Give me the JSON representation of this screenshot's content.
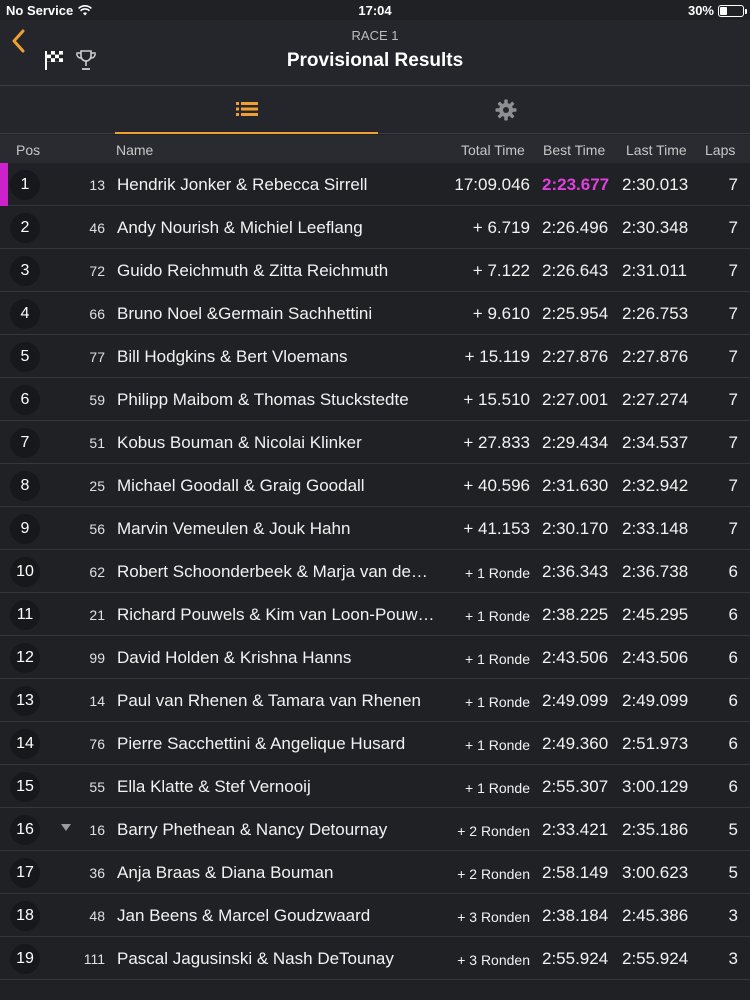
{
  "status_bar": {
    "carrier": "No Service",
    "time": "17:04",
    "battery": "30%",
    "battery_level": 0.3
  },
  "header": {
    "subtitle": "RACE 1",
    "title": "Provisional Results",
    "icons": [
      "chevron-left-icon",
      "checkered-flag-icon",
      "trophy-icon"
    ]
  },
  "tabs": [
    {
      "icon": "list-icon",
      "active": true
    },
    {
      "icon": "gear-icon",
      "active": false
    }
  ],
  "columns": {
    "pos": "Pos",
    "name": "Name",
    "total": "Total Time",
    "best": "Best Time",
    "last": "Last Time",
    "laps": "Laps"
  },
  "colors": {
    "accent": "#f0a030",
    "best_highlight": "#e040e0"
  },
  "rows": [
    {
      "pos": "1",
      "num": "13",
      "name": "Hendrik Jonker & Rebecca Sirrell",
      "total": "17:09.046",
      "best": "2:23.677",
      "last": "2:30.013",
      "laps": "7",
      "fastest": true
    },
    {
      "pos": "2",
      "num": "46",
      "name": "Andy Nourish & Michiel Leeflang",
      "total": "+ 6.719",
      "best": "2:26.496",
      "last": "2:30.348",
      "laps": "7"
    },
    {
      "pos": "3",
      "num": "72",
      "name": "Guido Reichmuth & Zitta Reichmuth",
      "total": "+ 7.122",
      "best": "2:26.643",
      "last": "2:31.011",
      "laps": "7"
    },
    {
      "pos": "4",
      "num": "66",
      "name": "Bruno Noel &Germain Sachhettini",
      "total": "+ 9.610",
      "best": "2:25.954",
      "last": "2:26.753",
      "laps": "7"
    },
    {
      "pos": "5",
      "num": "77",
      "name": "Bill Hodgkins & Bert Vloemans",
      "total": "+ 15.119",
      "best": "2:27.876",
      "last": "2:27.876",
      "laps": "7"
    },
    {
      "pos": "6",
      "num": "59",
      "name": "Philipp Maibom & Thomas Stuckstedte",
      "total": "+ 15.510",
      "best": "2:27.001",
      "last": "2:27.274",
      "laps": "7"
    },
    {
      "pos": "7",
      "num": "51",
      "name": "Kobus Bouman & Nicolai Klinker",
      "total": "+ 27.833",
      "best": "2:29.434",
      "last": "2:34.537",
      "laps": "7"
    },
    {
      "pos": "8",
      "num": "25",
      "name": "Michael Goodall & Graig Goodall",
      "total": "+ 40.596",
      "best": "2:31.630",
      "last": "2:32.942",
      "laps": "7"
    },
    {
      "pos": "9",
      "num": "56",
      "name": "Marvin Vemeulen & Jouk Hahn",
      "total": "+ 41.153",
      "best": "2:30.170",
      "last": "2:33.148",
      "laps": "7"
    },
    {
      "pos": "10",
      "num": "62",
      "name": "Robert Schoonderbeek & Marja van de…",
      "total": "+ 1 Ronde",
      "best": "2:36.343",
      "last": "2:36.738",
      "laps": "6"
    },
    {
      "pos": "11",
      "num": "21",
      "name": "Richard Pouwels & Kim van Loon-Pouw…",
      "total": "+ 1 Ronde",
      "best": "2:38.225",
      "last": "2:45.295",
      "laps": "6"
    },
    {
      "pos": "12",
      "num": "99",
      "name": "David Holden & Krishna Hanns",
      "total": "+ 1 Ronde",
      "best": "2:43.506",
      "last": "2:43.506",
      "laps": "6"
    },
    {
      "pos": "13",
      "num": "14",
      "name": "Paul van Rhenen & Tamara van Rhenen",
      "total": "+ 1 Ronde",
      "best": "2:49.099",
      "last": "2:49.099",
      "laps": "6"
    },
    {
      "pos": "14",
      "num": "76",
      "name": "Pierre Sacchettini & Angelique Husard",
      "total": "+ 1 Ronde",
      "best": "2:49.360",
      "last": "2:51.973",
      "laps": "6"
    },
    {
      "pos": "15",
      "num": "55",
      "name": "Ella Klatte & Stef Vernooij",
      "total": "+ 1 Ronde",
      "best": "2:55.307",
      "last": "3:00.129",
      "laps": "6"
    },
    {
      "pos": "16",
      "num": "16",
      "name": "Barry Phethean & Nancy Detournay",
      "total": "+ 2 Ronden",
      "best": "2:33.421",
      "last": "2:35.186",
      "laps": "5",
      "arrow": "down"
    },
    {
      "pos": "17",
      "num": "36",
      "name": "Anja Braas & Diana Bouman",
      "total": "+ 2 Ronden",
      "best": "2:58.149",
      "last": "3:00.623",
      "laps": "5"
    },
    {
      "pos": "18",
      "num": "48",
      "name": "Jan Beens & Marcel Goudzwaard",
      "total": "+ 3 Ronden",
      "best": "2:38.184",
      "last": "2:45.386",
      "laps": "3"
    },
    {
      "pos": "19",
      "num": "111",
      "name": "Pascal Jagusinski & Nash DeTounay",
      "total": "+ 3 Ronden",
      "best": "2:55.924",
      "last": "2:55.924",
      "laps": "3"
    }
  ]
}
